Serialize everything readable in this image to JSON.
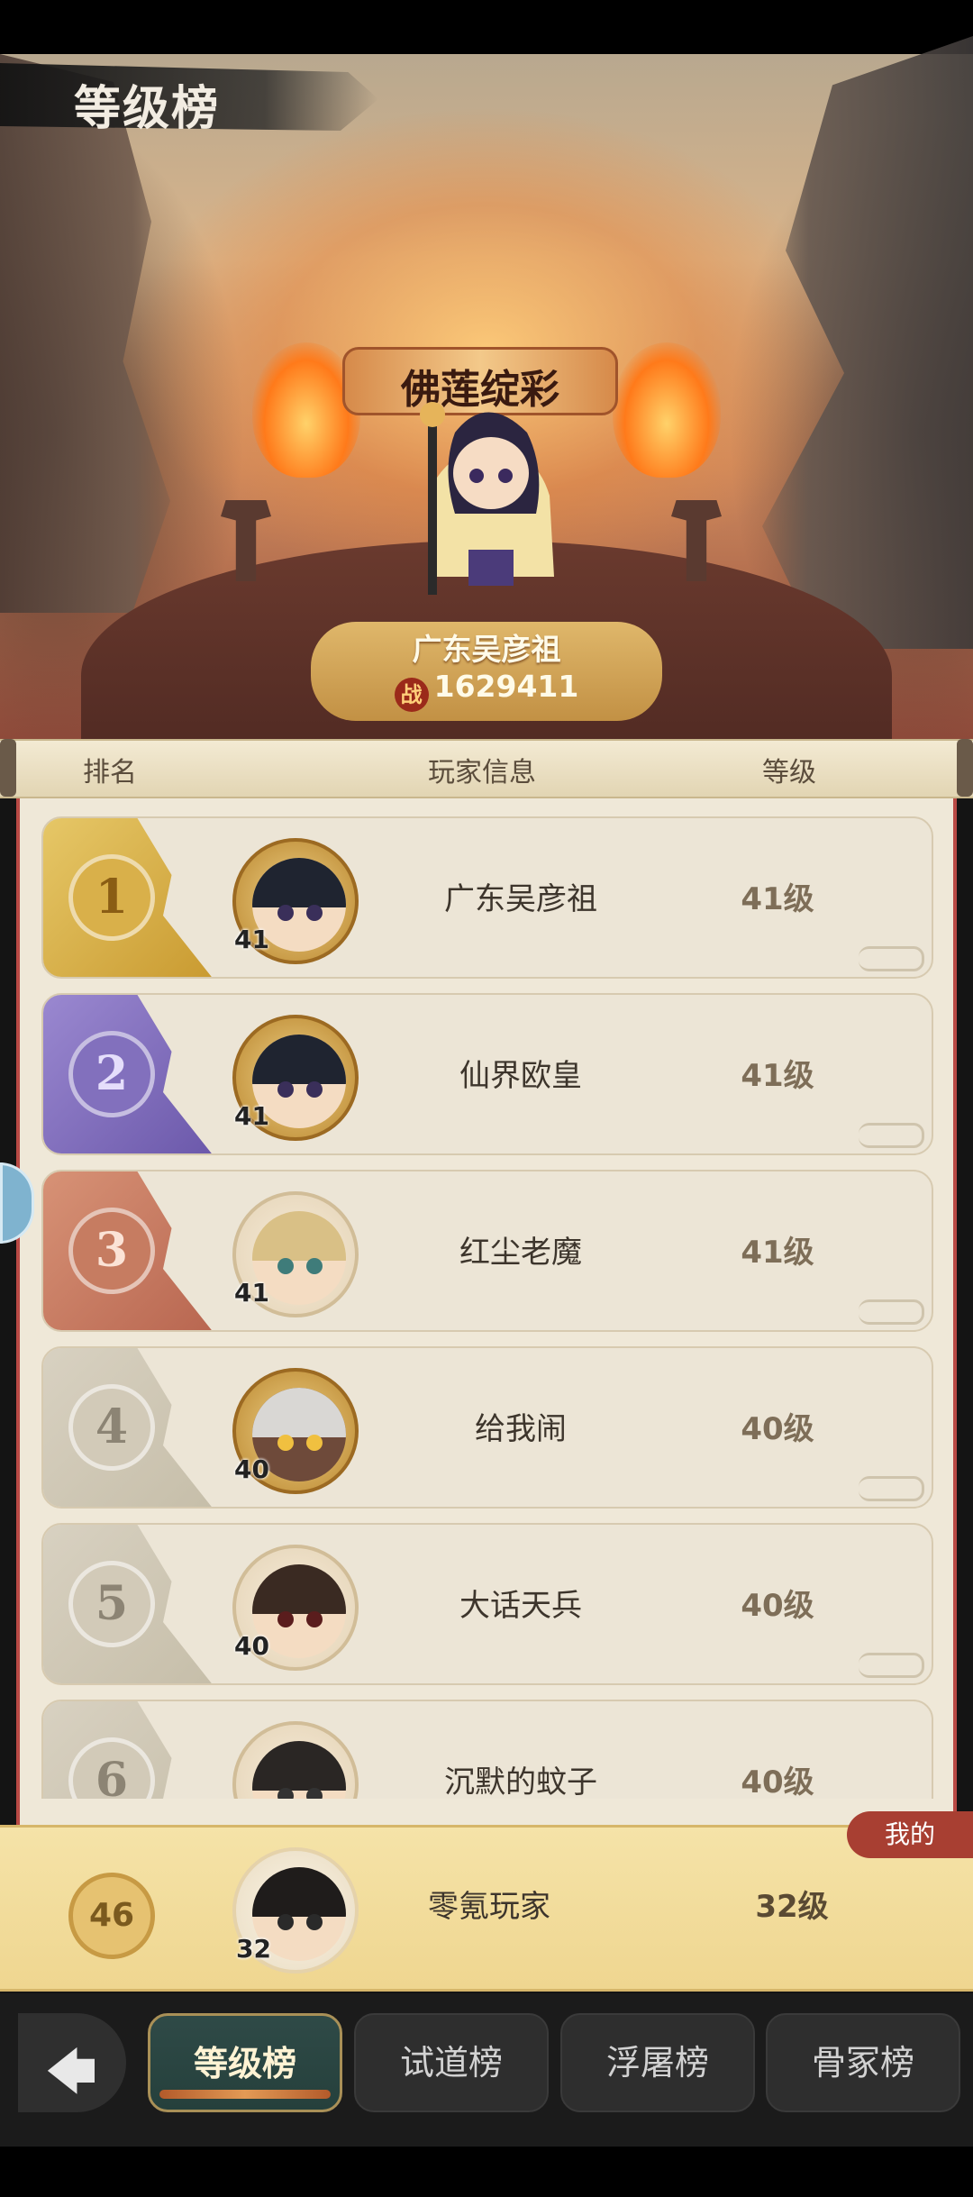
{
  "header": {
    "title": "等级榜"
  },
  "champion": {
    "title_plaque": "佛莲绽彩",
    "name": "广东吴彦祖",
    "power_icon": "战",
    "power": "1629411"
  },
  "columns": {
    "rank": "排名",
    "player": "玩家信息",
    "level": "等级"
  },
  "rows": [
    {
      "rank": "1",
      "avatar_level": "41",
      "name": "广东吴彦祖",
      "level": "41级"
    },
    {
      "rank": "2",
      "avatar_level": "41",
      "name": "仙界欧皇",
      "level": "41级"
    },
    {
      "rank": "3",
      "avatar_level": "41",
      "name": "红尘老魔",
      "level": "41级"
    },
    {
      "rank": "4",
      "avatar_level": "40",
      "name": "给我闹",
      "level": "40级"
    },
    {
      "rank": "5",
      "avatar_level": "40",
      "name": "大话天兵",
      "level": "40级"
    },
    {
      "rank": "6",
      "avatar_level": "",
      "name": "沉默的蚊子",
      "level": "40级"
    }
  ],
  "my_rank": {
    "tag": "我的",
    "rank": "46",
    "avatar_level": "32",
    "name": "零氪玩家",
    "level": "32级"
  },
  "tabs": [
    {
      "label": "等级榜",
      "active": true
    },
    {
      "label": "试道榜",
      "active": false
    },
    {
      "label": "浮屠榜",
      "active": false
    },
    {
      "label": "骨冢榜",
      "active": false
    }
  ],
  "colors": {
    "gold": "#cda83e",
    "purple": "#7f6cbc",
    "bronze": "#c0745a",
    "gray": "#cfc8b8",
    "accent_red": "#b94a45"
  },
  "icons": {
    "back": "back-arrow-icon"
  }
}
